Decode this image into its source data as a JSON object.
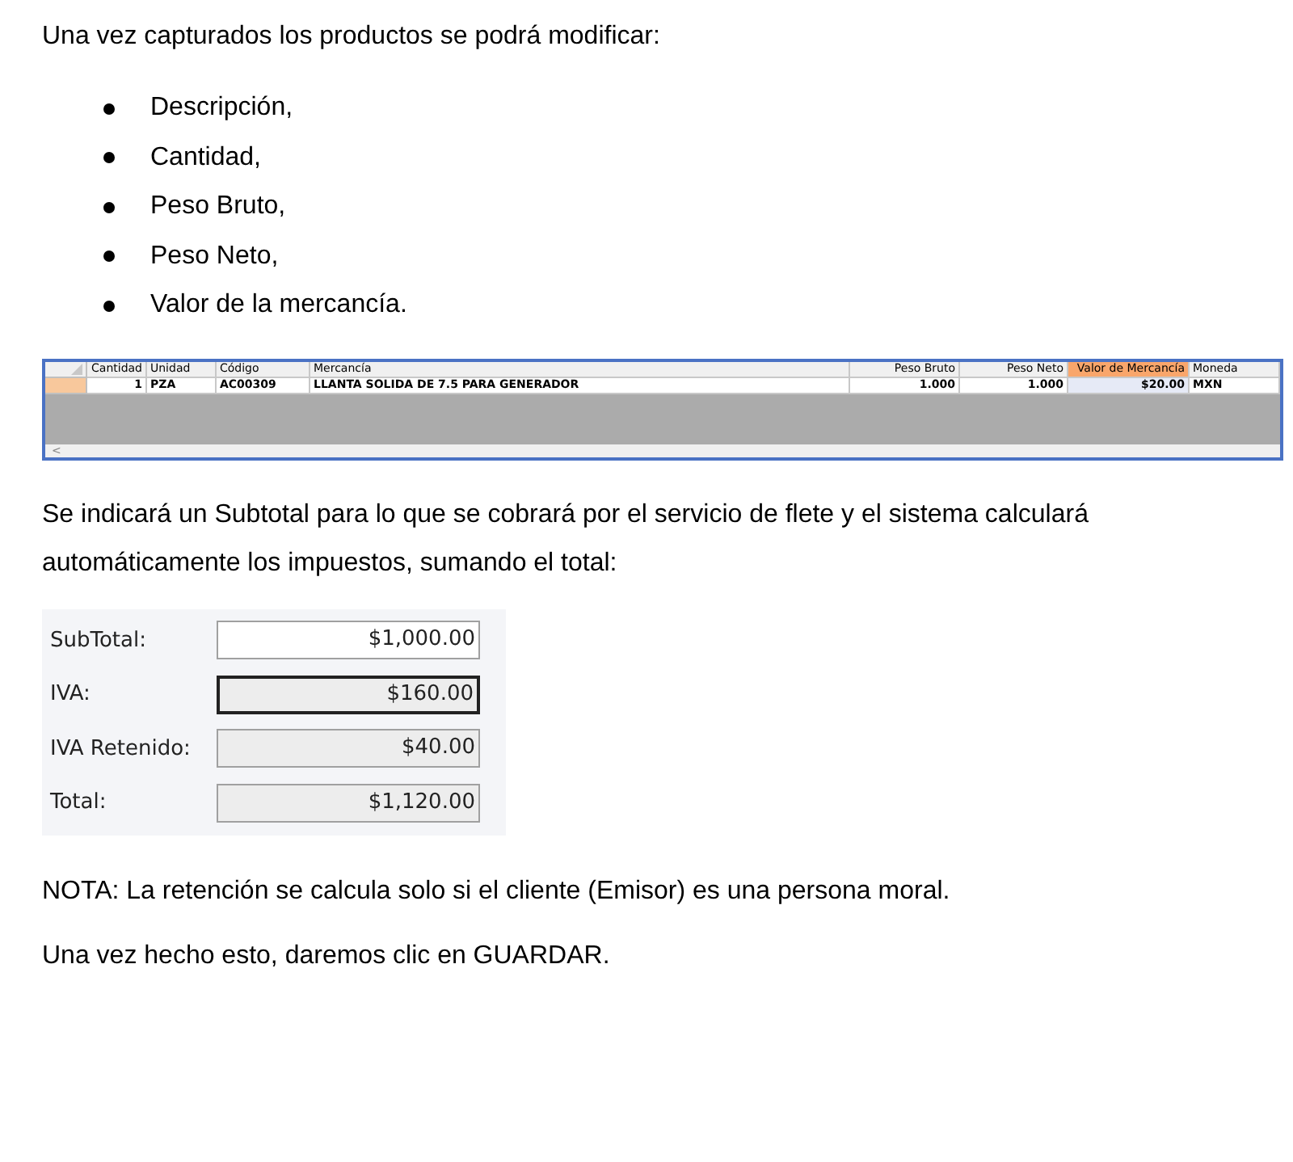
{
  "intro": "Una vez capturados los productos se podrá modificar:",
  "bullets": [
    "Descripción,",
    "Cantidad,",
    "Peso Bruto,",
    "Peso Neto,",
    "Valor de la mercancía."
  ],
  "grid": {
    "columns": [
      {
        "label": "Cantidad",
        "selected": false
      },
      {
        "label": "Unidad",
        "selected": false
      },
      {
        "label": "Código",
        "selected": false
      },
      {
        "label": "Mercancía",
        "selected": false
      },
      {
        "label": "Peso Bruto",
        "selected": false
      },
      {
        "label": "Peso Neto",
        "selected": false
      },
      {
        "label": "Valor de Mercancía",
        "selected": true
      },
      {
        "label": "Moneda",
        "selected": false
      }
    ],
    "rows": [
      {
        "selected": true,
        "cells": [
          {
            "text": "1",
            "selected": false
          },
          {
            "text": "PZA",
            "selected": false
          },
          {
            "text": "AC00309",
            "selected": false
          },
          {
            "text": "LLANTA  SOLIDA DE 7.5  PARA GENERADOR",
            "selected": false
          },
          {
            "text": "1.000",
            "selected": false
          },
          {
            "text": "1.000",
            "selected": false
          },
          {
            "text": "$20.00",
            "selected": true
          },
          {
            "text": "MXN",
            "selected": false
          }
        ]
      }
    ],
    "scroll_hint": "<"
  },
  "paragraph": "Se indicará un Subtotal para lo que se cobrará por el servicio de flete y el sistema calculará automáticamente los impuestos, sumando el total:",
  "totals": [
    {
      "label": "SubTotal:",
      "value": "$1,000.00",
      "disabled": false,
      "focused": false
    },
    {
      "label": "IVA:",
      "value": "$160.00",
      "disabled": true,
      "focused": true
    },
    {
      "label": "IVA Retenido:",
      "value": "$40.00",
      "disabled": true,
      "focused": false
    },
    {
      "label": "Total:",
      "value": "$1,120.00",
      "disabled": true,
      "focused": false
    }
  ],
  "note": "NOTA: La retención se calcula solo si el cliente (Emisor) es una persona moral.",
  "closing": "Una vez hecho esto, daremos clic en GUARDAR."
}
